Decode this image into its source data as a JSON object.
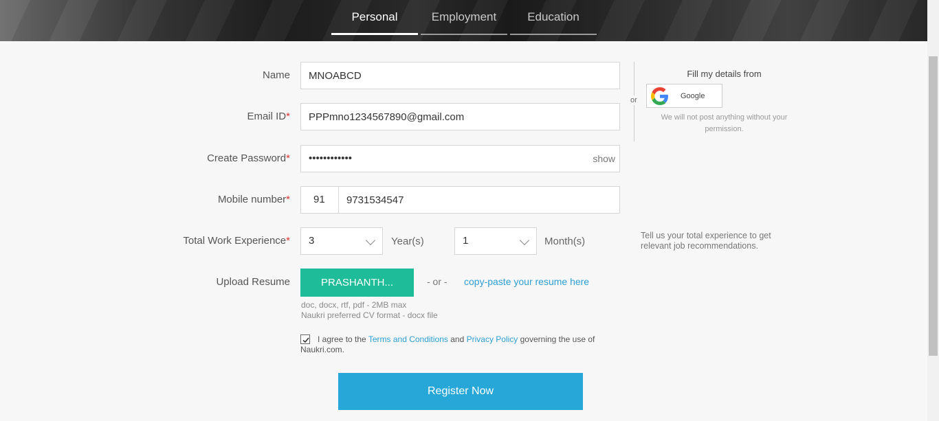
{
  "tabs": [
    {
      "label": "Personal",
      "active": true
    },
    {
      "label": "Employment",
      "active": false
    },
    {
      "label": "Education",
      "active": false
    }
  ],
  "form": {
    "name": {
      "label": "Name",
      "value": "MNOABCD"
    },
    "email": {
      "label": "Email ID",
      "required_mark": "*",
      "value": "PPPmno1234567890@gmail.com"
    },
    "password": {
      "label": "Create Password",
      "required_mark": "*",
      "value": "••••••••••••",
      "show_label": "show"
    },
    "mobile": {
      "label": "Mobile number",
      "required_mark": "*",
      "country_code": "91",
      "number": "9731534547"
    },
    "experience": {
      "label": "Total Work Experience",
      "required_mark": "*",
      "years": "3",
      "years_unit": "Year(s)",
      "months": "1",
      "months_unit": "Month(s)"
    },
    "resume": {
      "label": "Upload Resume",
      "file_button": "PRASHANTH...",
      "or_text": "- or -",
      "copy_paste": "copy-paste your resume here",
      "formats_hint": "doc, docx, rtf, pdf - 2MB max",
      "preferred_hint": "Naukri preferred CV format - docx file"
    },
    "agree": {
      "checked": true,
      "prefix": "I agree to the ",
      "terms_link": "Terms and Conditions",
      "middle": " and ",
      "privacy_link": "Privacy Policy",
      "suffix": " governing the use of Naukri.com."
    },
    "submit_label": "Register Now"
  },
  "side": {
    "or_label": "or",
    "fill_title": "Fill my details from",
    "google_label": "Google",
    "permission_note": "We will not post anything without your permission.",
    "experience_tip": "Tell us your total experience to get relevant job recommendations."
  },
  "colors": {
    "upload_button": "#1fbc99",
    "register_button": "#27a7d8",
    "link": "#2e9fd3",
    "required": "#dd3333"
  }
}
